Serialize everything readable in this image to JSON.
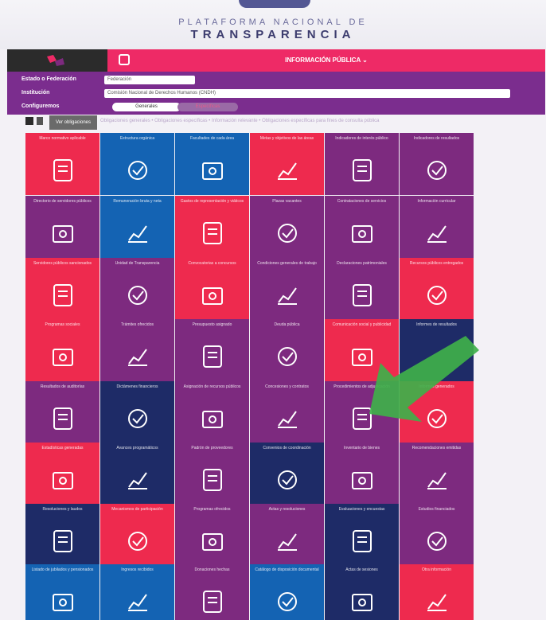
{
  "header": {
    "line1": "PLATAFORMA NACIONAL DE",
    "line2": "TRANSPARENCIA"
  },
  "topbar": {
    "menu_label": "INFORMACIÓN PÚBLICA ⌄"
  },
  "filters": {
    "estado_label": "Estado o Federación",
    "estado_value": "Federación",
    "institucion_label": "Institución",
    "institucion_value": "Comisión Nacional de Derechos Humanos (CNDH)",
    "config_label": "Configuremos",
    "toggle_left": "Generales",
    "toggle_right": "Específicas"
  },
  "viewbar": {
    "label": "Ver obligaciones",
    "text": "Obligaciones generales  •  Obligaciones específicas  •  Información relevante  •  Obligaciones específicas para fines de consulta pública"
  },
  "colors": {
    "red": "#ee2a4e",
    "purple": "#7d2a7f",
    "blue": "#1463b3",
    "navy": "#1e2b67",
    "pink": "#ee2a66",
    "green_arrow": "#3fb04a"
  },
  "tiles": [
    {
      "c": "red",
      "icon": "book-icon",
      "label": "Marco normativo aplicable"
    },
    {
      "c": "blue",
      "icon": "contract-icon",
      "label": "Estructura orgánica"
    },
    {
      "c": "blue",
      "icon": "document-person-icon",
      "label": "Facultades de cada área"
    },
    {
      "c": "red",
      "icon": "search-document-icon",
      "label": "Metas y objetivos de las áreas"
    },
    {
      "c": "purple",
      "icon": "gears-icon",
      "label": "Indicadores de interés público"
    },
    {
      "c": "purple",
      "icon": "clipboard-icon",
      "label": "Indicadores de resultados"
    },
    {
      "c": "purple",
      "icon": "resume-icon",
      "label": "Directorio de servidores públicos"
    },
    {
      "c": "blue",
      "icon": "compare-docs-icon",
      "label": "Remuneración bruta y neta"
    },
    {
      "c": "red",
      "icon": "id-card-icon",
      "label": "Gastos de representación y viáticos"
    },
    {
      "c": "purple",
      "icon": "house-document-icon",
      "label": "Plazas vacantes"
    },
    {
      "c": "purple",
      "icon": "scale-money-icon",
      "label": "Contrataciones de servicios"
    },
    {
      "c": "purple",
      "icon": "chart-board-icon",
      "label": "Información curricular"
    },
    {
      "c": "red",
      "icon": "contacts-icon",
      "label": "Servidores públicos sancionados"
    },
    {
      "c": "purple",
      "icon": "box-icon",
      "label": "Unidad de Transparencia"
    },
    {
      "c": "red",
      "icon": "bar-growth-icon",
      "label": "Convocatorias a concursos"
    },
    {
      "c": "purple",
      "icon": "org-chart-icon",
      "label": "Condiciones generales de trabajo"
    },
    {
      "c": "purple",
      "icon": "coins-stack-icon",
      "label": "Declaraciones patrimoniales"
    },
    {
      "c": "red",
      "icon": "money-transfer-icon",
      "label": "Recursos públicos entregados"
    },
    {
      "c": "red",
      "icon": "settings-icon",
      "label": "Programas sociales"
    },
    {
      "c": "purple",
      "icon": "chat-icon",
      "label": "Trámites ofrecidos"
    },
    {
      "c": "purple",
      "icon": "safe-icon",
      "label": "Presupuesto asignado"
    },
    {
      "c": "purple",
      "icon": "people-chart-icon",
      "label": "Deuda pública"
    },
    {
      "c": "red",
      "icon": "report-check-icon",
      "label": "Comunicación social y publicidad"
    },
    {
      "c": "navy",
      "icon": "empty-icon",
      "label": "Informes de resultados"
    },
    {
      "c": "purple",
      "icon": "money-book-icon",
      "label": "Resultados de auditorías"
    },
    {
      "c": "navy",
      "icon": "book-icon",
      "label": "Dictámenes financieros"
    },
    {
      "c": "purple",
      "icon": "hand-money-icon",
      "label": "Asignación de recursos públicos"
    },
    {
      "c": "purple",
      "icon": "blocks-icon",
      "label": "Concesiones y contratos"
    },
    {
      "c": "purple",
      "icon": "document-chain-icon",
      "label": "Procedimientos de adjudicación"
    },
    {
      "c": "red",
      "icon": "puzzle-icon",
      "label": "Informes generados"
    },
    {
      "c": "red",
      "icon": "gavel-book-icon",
      "label": "Estadísticas generadas"
    },
    {
      "c": "navy",
      "icon": "folder-doc-icon",
      "label": "Avances programáticos"
    },
    {
      "c": "purple",
      "icon": "people-exchange-icon",
      "label": "Padrón de proveedores"
    },
    {
      "c": "navy",
      "icon": "hands-icon",
      "label": "Convenios de coordinación"
    },
    {
      "c": "purple",
      "icon": "people-money-icon",
      "label": "Inventario de bienes"
    },
    {
      "c": "purple",
      "icon": "notes-icon",
      "label": "Recomendaciones emitidas"
    },
    {
      "c": "navy",
      "icon": "money-people-icon",
      "label": "Resoluciones y laudos"
    },
    {
      "c": "red",
      "icon": "network-icon",
      "label": "Mecanismos de participación"
    },
    {
      "c": "purple",
      "icon": "balance-people-icon",
      "label": "Programas ofrecidos"
    },
    {
      "c": "purple",
      "icon": "calendar-doc-icon",
      "label": "Actas y resoluciones"
    },
    {
      "c": "navy",
      "icon": "hand-gear-icon",
      "label": "Evaluaciones y encuestas"
    },
    {
      "c": "purple",
      "icon": "people-grid-icon",
      "label": "Estudios financiados"
    },
    {
      "c": "blue",
      "icon": "docs-people-icon",
      "label": "Listado de jubilados y pensionados"
    },
    {
      "c": "blue",
      "icon": "gavel-icon",
      "label": "Ingresos recibidos"
    },
    {
      "c": "purple",
      "icon": "money-bills-icon",
      "label": "Donaciones hechas"
    },
    {
      "c": "blue",
      "icon": "list-doc-icon",
      "label": "Catálogo de disposición documental"
    },
    {
      "c": "navy",
      "icon": "scroll-icon",
      "label": "Actas de sesiones"
    },
    {
      "c": "red",
      "icon": "location-icon",
      "label": "Otra información"
    }
  ]
}
